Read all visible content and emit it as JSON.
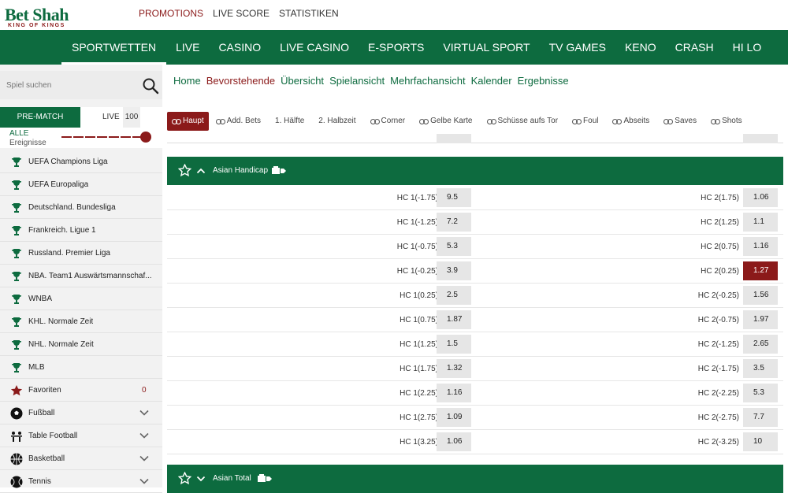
{
  "brand": {
    "name": "Bet Shah",
    "tagline": "KING OF KINGS",
    "color": "#0d6b3f",
    "accent": "#8b1a1a"
  },
  "toplinks": [
    "PROMOTIONS",
    "LIVE SCORE",
    "STATISTIKEN"
  ],
  "mainnav": [
    "SPORTWETTEN",
    "LIVE",
    "CASINO",
    "LIVE CASINO",
    "E-SPORTS",
    "VIRTUAL SPORT",
    "TV GAMES",
    "KENO",
    "CRASH",
    "HI LO"
  ],
  "search": {
    "placeholder": "Spiel suchen"
  },
  "sidebar": {
    "tabs": {
      "prematch": "PRE-MATCH",
      "live": "LIVE",
      "live_count": "100"
    },
    "filter": {
      "label": "ALLE",
      "sub": "Ereignisse"
    },
    "items": [
      {
        "label": "UEFA Champions Liga",
        "icon": "trophy-icon"
      },
      {
        "label": "UEFA Europaliga",
        "icon": "trophy-icon"
      },
      {
        "label": "Deutschland. Bundesliga",
        "icon": "trophy-icon"
      },
      {
        "label": "Frankreich. Ligue 1",
        "icon": "trophy-icon"
      },
      {
        "label": "Russland. Premier Liga",
        "icon": "trophy-icon"
      },
      {
        "label": "NBA. Team1 Auswärtsmannschaf...",
        "icon": "trophy-icon"
      },
      {
        "label": "WNBA",
        "icon": "trophy-icon"
      },
      {
        "label": "KHL. Normale Zeit",
        "icon": "trophy-icon"
      },
      {
        "label": "NHL. Normale Zeit",
        "icon": "trophy-icon"
      },
      {
        "label": "MLB",
        "icon": "trophy-icon"
      },
      {
        "label": "Favoriten",
        "icon": "star-icon",
        "count": "0"
      },
      {
        "label": "Fußball",
        "icon": "soccer-ball-icon"
      },
      {
        "label": "Table Football",
        "icon": "table-football-icon"
      },
      {
        "label": "Basketball",
        "icon": "basketball-icon"
      },
      {
        "label": "Tennis",
        "icon": "tennis-ball-icon"
      }
    ]
  },
  "breadcrumbs": [
    "Home",
    "Bevorstehende",
    "Übersicht",
    "Spielansicht",
    "Mehrfachansicht",
    "Kalender",
    "Ergebnisse"
  ],
  "market_tabs": [
    "Haupt",
    "Add. Bets",
    "1. Hälfte",
    "2. Halbzeit",
    "Corner",
    "Gelbe Karte",
    "Schüsse aufs Tor",
    "Foul",
    "Abseits",
    "Saves",
    "Shots"
  ],
  "sections": {
    "asian_handicap": {
      "title": "Asian Handicap",
      "rows": [
        {
          "l": "HC 1(-1.75)",
          "lo": "9.5",
          "r": "HC 2(1.75)",
          "ro": "1.06"
        },
        {
          "l": "HC 1(-1.25)",
          "lo": "7.2",
          "r": "HC 2(1.25)",
          "ro": "1.1"
        },
        {
          "l": "HC 1(-0.75)",
          "lo": "5.3",
          "r": "HC 2(0.75)",
          "ro": "1.16"
        },
        {
          "l": "HC 1(-0.25)",
          "lo": "3.9",
          "r": "HC 2(0.25)",
          "ro": "1.27",
          "selected": true
        },
        {
          "l": "HC 1(0.25)",
          "lo": "2.5",
          "r": "HC 2(-0.25)",
          "ro": "1.56"
        },
        {
          "l": "HC 1(0.75)",
          "lo": "1.87",
          "r": "HC 2(-0.75)",
          "ro": "1.97"
        },
        {
          "l": "HC 1(1.25)",
          "lo": "1.5",
          "r": "HC 2(-1.25)",
          "ro": "2.65"
        },
        {
          "l": "HC 1(1.75)",
          "lo": "1.32",
          "r": "HC 2(-1.75)",
          "ro": "3.5"
        },
        {
          "l": "HC 1(2.25)",
          "lo": "1.16",
          "r": "HC 2(-2.25)",
          "ro": "5.3"
        },
        {
          "l": "HC 1(2.75)",
          "lo": "1.09",
          "r": "HC 2(-2.75)",
          "ro": "7.7"
        },
        {
          "l": "HC 1(3.25)",
          "lo": "1.06",
          "r": "HC 2(-3.25)",
          "ro": "10"
        }
      ]
    },
    "asian_total": {
      "title": "Asian Total"
    }
  }
}
